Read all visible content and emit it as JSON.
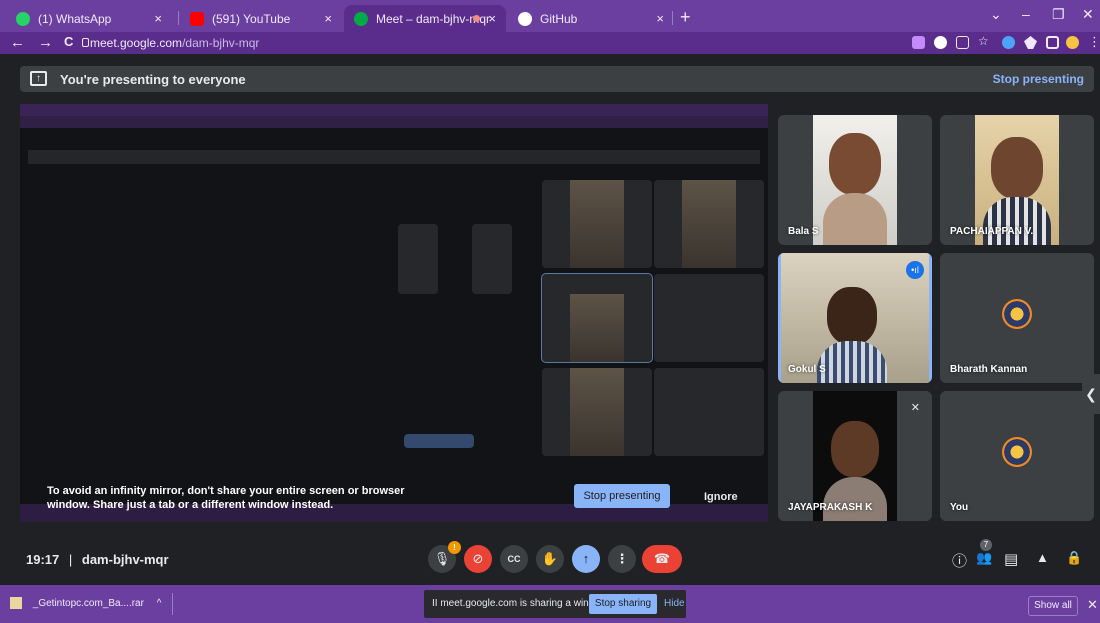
{
  "browser": {
    "tabs": [
      {
        "label": "(1) WhatsApp",
        "close": "×",
        "color": "#25d366"
      },
      {
        "label": "(591) YouTube",
        "close": "×",
        "color": "#ff0000"
      },
      {
        "label": "Meet – dam-bjhv-mqr",
        "close": "×",
        "color": "#00ac47"
      },
      {
        "label": "GitHub",
        "close": "×",
        "color": "#ffffff"
      }
    ],
    "new_tab": "+",
    "window_controls": {
      "chevron": "⌄",
      "minimize": "–",
      "restore": "❐",
      "close": "✕"
    },
    "nav": {
      "back": "←",
      "forward": "→",
      "reload": "C"
    },
    "url_host": "meet.google.com",
    "url_path": "/dam-bjhv-mqr",
    "menu": "⋮"
  },
  "banner": {
    "icon": "present-icon",
    "glyph": "↑",
    "text": "You're presenting to everyone",
    "stop": "Stop presenting"
  },
  "warning": {
    "text": "To avoid an infinity mirror, don't share your entire screen or browser window. Share just a tab or a different window instead.",
    "stop_button": "Stop presenting",
    "ignore_button": "Ignore"
  },
  "participants": [
    {
      "name": "Bala S",
      "video": true
    },
    {
      "name": "PACHAIAPPAN V.",
      "video": true
    },
    {
      "name": "Gokul S",
      "video": true,
      "speaking": true
    },
    {
      "name": "Bharath Kannan",
      "video": false
    },
    {
      "name": "JAYAPRAKASH K",
      "video": true,
      "muted": true
    },
    {
      "name": "You",
      "video": false
    }
  ],
  "meeting": {
    "time": "19:17",
    "separator": "|",
    "code": "dam-bjhv-mqr",
    "participant_count": "7",
    "mic_badge": "!"
  },
  "controls": {
    "mic": "🎙",
    "camera": "⊘",
    "captions": "CC",
    "hand": "✋",
    "present": "↑",
    "more": "⋮",
    "hangup": "☎",
    "info": "ⓘ",
    "people": "👥",
    "chat": "▤",
    "activities": "▲",
    "lock": "🔒",
    "side_panel": "❮"
  },
  "downloads": {
    "file": "_Getintopc.com_Ba....rar",
    "chevron": "^",
    "show_all": "Show all",
    "close": "✕"
  },
  "sharing_bar": {
    "text": "II  meet.google.com is sharing a window.",
    "stop": "Stop sharing",
    "hide": "Hide"
  }
}
